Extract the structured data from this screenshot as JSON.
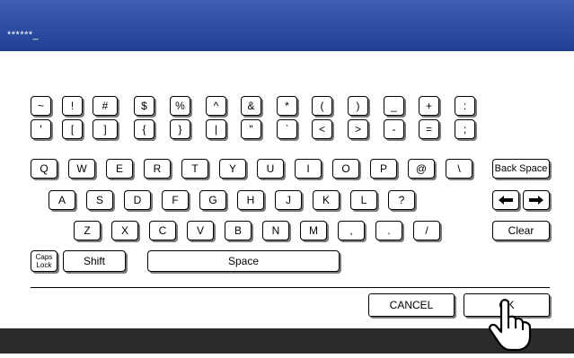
{
  "input": {
    "value": "******_"
  },
  "keys": {
    "r1": [
      "~",
      "!",
      "#",
      "$",
      "%",
      "^",
      "&",
      "*",
      "(",
      ")",
      "_",
      "+",
      ":"
    ],
    "r2": [
      "'",
      "[",
      "]",
      "{",
      "}",
      "|",
      "\"",
      "`",
      "<",
      ">",
      "-",
      "=",
      ";"
    ],
    "r3": [
      "Q",
      "W",
      "E",
      "R",
      "T",
      "Y",
      "U",
      "I",
      "O",
      "P",
      "@",
      "\\"
    ],
    "r4": [
      "A",
      "S",
      "D",
      "F",
      "G",
      "H",
      "J",
      "K",
      "L",
      "?"
    ],
    "r5": [
      "Z",
      "X",
      "C",
      "V",
      "B",
      "N",
      "M",
      ",",
      ".",
      "/"
    ],
    "r1d": [
      "~",
      "!",
      "#",
      "$",
      "%",
      "^",
      "&",
      "*",
      "(",
      ")",
      "_",
      "+",
      ":"
    ],
    "backspace": "Back Space",
    "clear": "Clear",
    "caps_line1": "Caps",
    "caps_line2": "Lock",
    "shift": "Shift",
    "space": "Space"
  },
  "actions": {
    "cancel": "CANCEL",
    "ok": "OK"
  },
  "icons": {
    "left_arrow": "left-arrow-icon",
    "right_arrow": "right-arrow-icon",
    "pointer": "hand-pointer-icon"
  },
  "colors": {
    "title_bar": "#2a4aa0",
    "bottom_bar": "#2b2b2b"
  }
}
